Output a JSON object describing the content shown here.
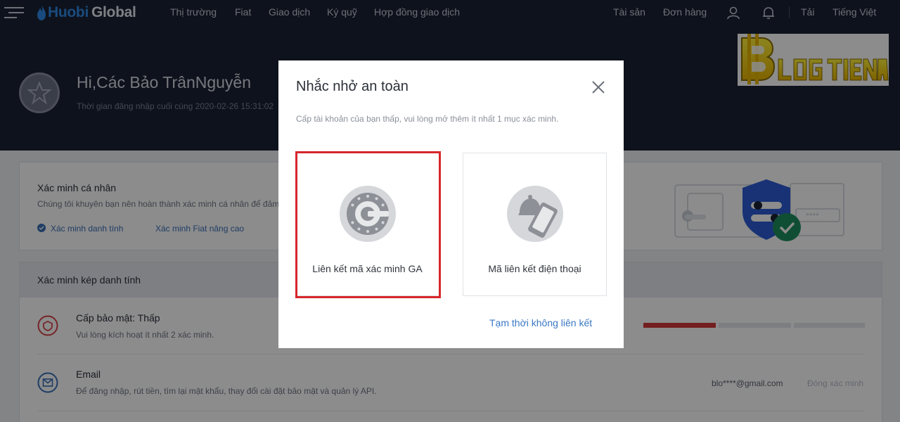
{
  "brand": {
    "name_part1": "Huobi",
    "name_part2": "Global"
  },
  "nav": {
    "items": [
      "Thị trường",
      "Fiat",
      "Giao dịch",
      "Ký quỹ",
      "Hợp đồng giao dịch"
    ],
    "right": {
      "assets": "Tài sản",
      "orders": "Đơn hàng",
      "download": "Tải",
      "language": "Tiếng Việt"
    }
  },
  "profile": {
    "greeting": "Hi,Các Bảo TrânNguyễn",
    "last_login": "Thời gian đăng nhập cuối cùng 2020-02-26 15:31:02"
  },
  "personal_verification": {
    "title": "Xác minh cá nhân",
    "description": "Chúng tôi khuyên bạn nên hoàn thành xác minh cá nhân để đảm",
    "links": [
      "Xác minh danh tính",
      "Xác minh Fiat nâng cao"
    ]
  },
  "two_factor": {
    "title": "Xác minh kép danh tính",
    "security_level": {
      "title": "Cấp bảo mật: Thấp",
      "description": "Vui lòng kích hoạt ít nhất 2 xác minh.",
      "level_fraction": 0.33
    },
    "email": {
      "title": "Email",
      "description": "Để đăng nhập, rút tiền, tìm lại mật khẩu, thay đổi cài đặt bảo mật và quản lý API.",
      "value": "blo****@gmail.com",
      "action": "Đóng xác minh"
    }
  },
  "modal": {
    "title": "Nhắc nhở an toàn",
    "description": "Cấp tài khoản của bạn thấp, vui lòng mở thêm ít nhất 1 mục xác minh.",
    "options": [
      {
        "label": "Liên kết mã xác minh GA",
        "icon": "google-authenticator-icon"
      },
      {
        "label": "Mã liên kết điện thoại",
        "icon": "phone-bell-icon"
      }
    ],
    "skip_link": "Tạm thời không liên kết"
  },
  "watermark": {
    "text": "BLOG TIỀN ẢO"
  },
  "colors": {
    "nav_bg": "#1b2233",
    "accent_blue": "#3b78c4",
    "danger_red": "#d7272c",
    "security_low": "#d33a3a"
  }
}
